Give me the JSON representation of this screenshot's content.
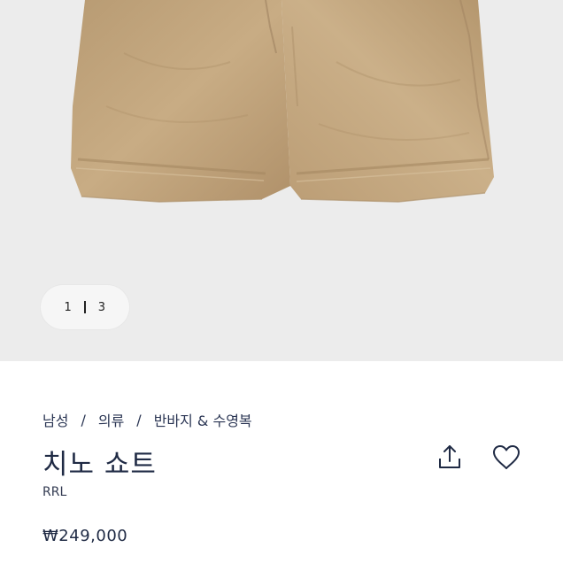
{
  "gallery": {
    "current_page": "1",
    "total_pages": "3"
  },
  "breadcrumb": {
    "items": [
      "남성",
      "의류",
      "반바지 & 수영복"
    ]
  },
  "product": {
    "name": "치노 쇼트",
    "brand": "RRL",
    "price": "₩249,000"
  },
  "icons": {
    "share": "share-icon",
    "like": "heart-icon"
  },
  "colors": {
    "text": "#1f2a44",
    "gallery_background": "#ececec",
    "product_khaki": "#c2a57d"
  }
}
